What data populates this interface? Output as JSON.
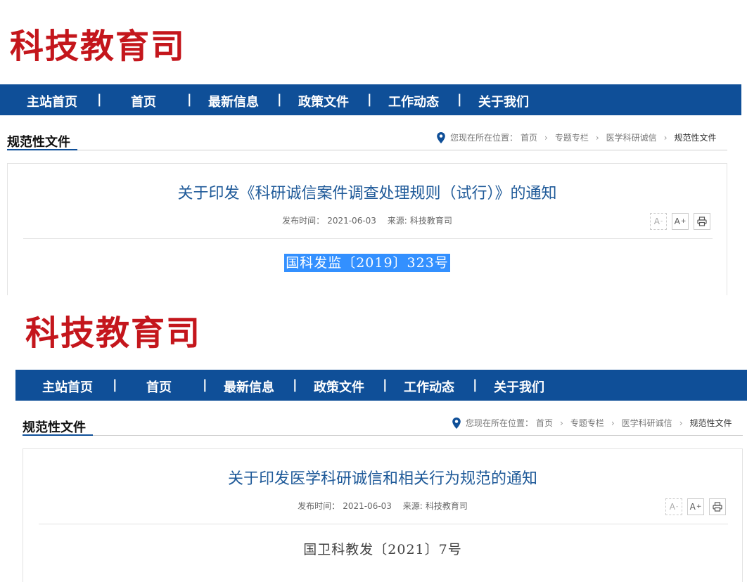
{
  "site": {
    "title": "科技教育司"
  },
  "nav": {
    "items": [
      "主站首页",
      "首页",
      "最新信息",
      "政策文件",
      "工作动态",
      "关于我们"
    ],
    "separator": "|"
  },
  "section": {
    "heading": "规范性文件"
  },
  "breadcrumb": {
    "prefix": "您现在所在位置：",
    "items": [
      "首页",
      "专题专栏",
      "医学科研诚信",
      "规范性文件"
    ]
  },
  "tools": {
    "decrease": "A",
    "increase": "A",
    "decrease_sup": "-",
    "increase_sup": "+"
  },
  "articles": [
    {
      "title": "关于印发《科研诚信案件调查处理规则（试行）》的通知",
      "publish_label": "发布时间：",
      "publish_date": "2021-06-03",
      "source_label": "来源:",
      "source": "科技教育司",
      "doc_number": "国科发监〔2019〕323号"
    },
    {
      "title": "关于印发医学科研诚信和相关行为规范的通知",
      "publish_label": "发布时间：",
      "publish_date": "2021-06-03",
      "source_label": "来源:",
      "source": "科技教育司",
      "doc_number": "国卫科教发〔2021〕7号"
    }
  ],
  "colors": {
    "brand_red": "#c4161c",
    "nav_blue": "#0f4f98",
    "title_blue": "#1f5a99",
    "selection": "#3390ff"
  }
}
